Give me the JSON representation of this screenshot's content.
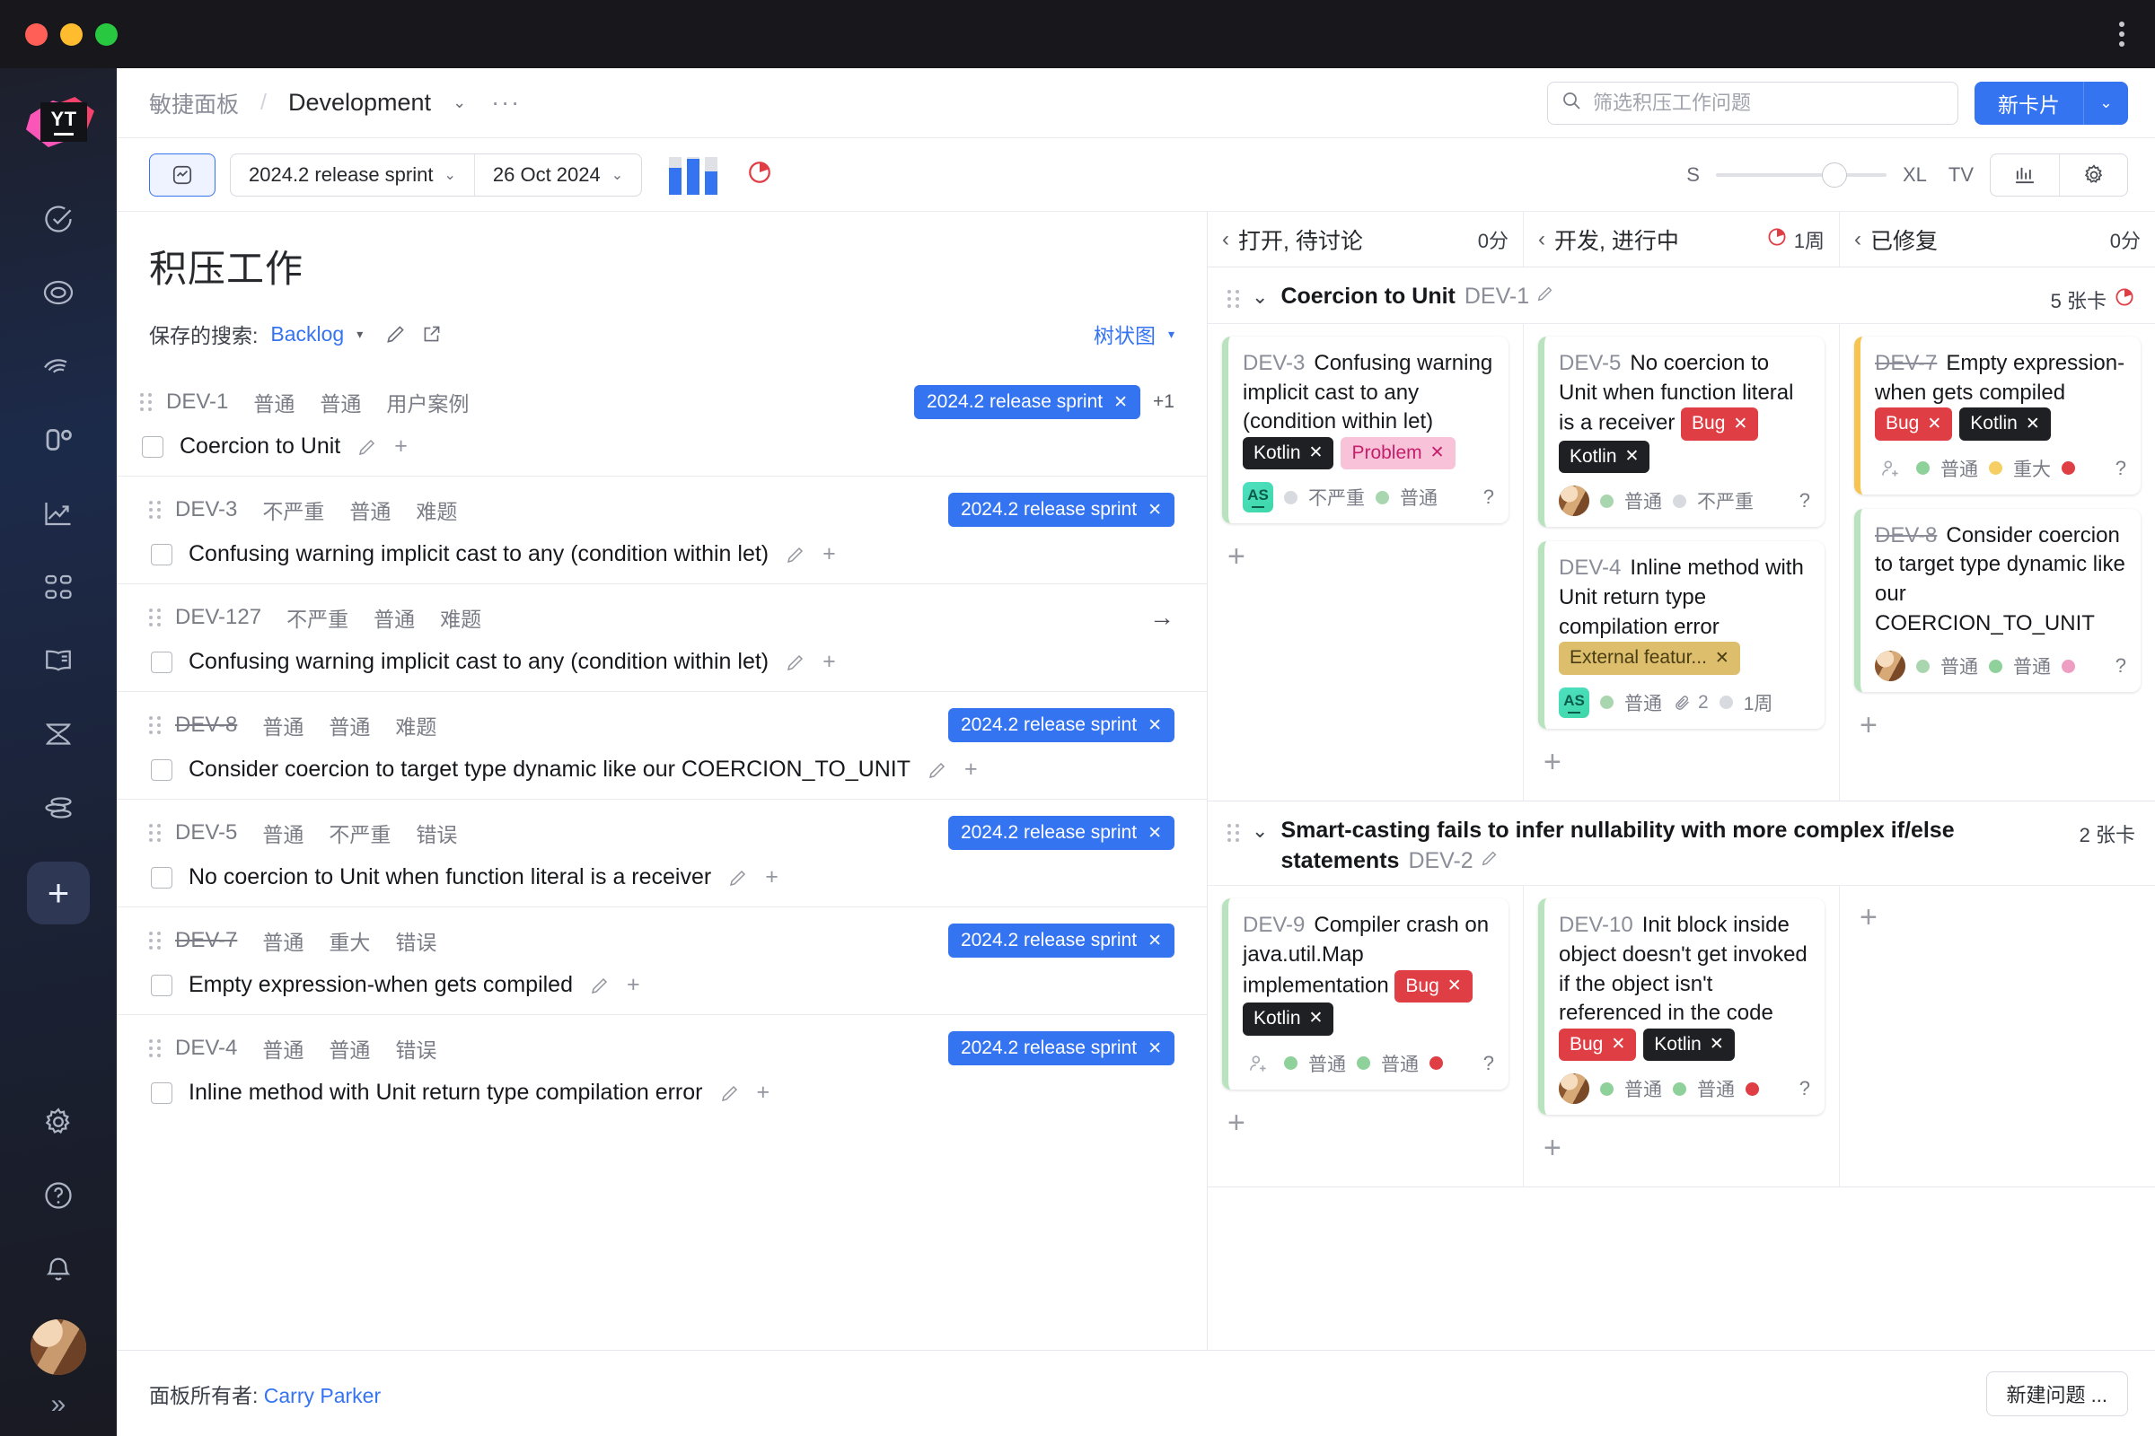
{
  "window": {
    "kebab_icon": "kebab-menu-icon"
  },
  "rail": {
    "logo_text": "YT",
    "icons": [
      {
        "name": "check-circle-icon"
      },
      {
        "name": "lifebuoy-icon"
      },
      {
        "name": "spiral-icon"
      },
      {
        "name": "zero-degree-icon"
      },
      {
        "name": "trend-chart-icon"
      },
      {
        "name": "grid-apps-icon"
      },
      {
        "name": "open-book-icon"
      },
      {
        "name": "hourglass-icon"
      },
      {
        "name": "stacked-lines-icon"
      }
    ],
    "add_label": "+",
    "bottom_icons": [
      {
        "name": "gear-icon"
      },
      {
        "name": "help-circle-icon"
      },
      {
        "name": "bell-icon"
      }
    ],
    "expand_label": "»"
  },
  "header": {
    "breadcrumb_root": "敏捷面板",
    "breadcrumb_sep": "/",
    "breadcrumb_current": "Development",
    "caret": "⌄",
    "more": "···",
    "search": {
      "placeholder": "筛选积压工作问题",
      "value": "",
      "icon": "search-icon"
    },
    "new_card_label": "新卡片",
    "new_card_caret": "⌄"
  },
  "toolbar": {
    "panel_toggle_icon": "board-panel-icon",
    "sprint_select": "2024.2 release sprint",
    "date_select": "26 Oct 2024",
    "chart_icon": "bar-chart-icon",
    "pie_icon": "pie-timer-icon",
    "size_min": "S",
    "size_max": "XL",
    "tv_label": "TV",
    "stats_icon": "statistics-icon",
    "settings_icon": "gear-icon"
  },
  "backlog": {
    "title": "积压工作",
    "saved_search_label": "保存的搜索:",
    "saved_search_value": "Backlog",
    "edit_icon": "pencil-icon",
    "open_icon": "external-link-icon",
    "view_mode": "树状图",
    "rows": [
      {
        "id": "DEV-1",
        "struck": false,
        "fields": [
          "普通",
          "普通",
          "用户案例"
        ],
        "sprint": "2024.2 release sprint",
        "extra": "+1",
        "name": "Coercion to Unit",
        "has_arrow": false
      },
      {
        "id": "DEV-3",
        "struck": false,
        "fields": [
          "不严重",
          "普通",
          "难题"
        ],
        "sprint": "2024.2 release sprint",
        "extra": "",
        "name": "Confusing warning implicit cast to any (condition within let)",
        "has_arrow": false
      },
      {
        "id": "DEV-127",
        "struck": false,
        "fields": [
          "不严重",
          "普通",
          "难题"
        ],
        "sprint": "",
        "extra": "",
        "name": "Confusing warning implicit cast to any (condition within let)",
        "has_arrow": true
      },
      {
        "id": "DEV-8",
        "struck": true,
        "fields": [
          "普通",
          "普通",
          "难题"
        ],
        "sprint": "2024.2 release sprint",
        "extra": "",
        "name": "Consider coercion to target type dynamic like our COERCION_TO_UNIT",
        "has_arrow": false
      },
      {
        "id": "DEV-5",
        "struck": false,
        "fields": [
          "普通",
          "不严重",
          "错误"
        ],
        "sprint": "2024.2 release sprint",
        "extra": "",
        "name": "No coercion to Unit when function literal is a receiver",
        "has_arrow": false
      },
      {
        "id": "DEV-7",
        "struck": true,
        "fields": [
          "普通",
          "重大",
          "错误"
        ],
        "sprint": "2024.2 release sprint",
        "extra": "",
        "name": "Empty expression-when gets compiled",
        "has_arrow": false
      },
      {
        "id": "DEV-4",
        "struck": false,
        "fields": [
          "普通",
          "普通",
          "错误"
        ],
        "sprint": "2024.2 release sprint",
        "extra": "",
        "name": "Inline method with Unit return type compilation error",
        "has_arrow": false
      }
    ]
  },
  "board": {
    "columns": [
      {
        "name": "打开, 待讨论",
        "badge": "0分",
        "badge_icon": ""
      },
      {
        "name": "开发, 进行中",
        "badge": "1周",
        "badge_icon": "pie-timer-icon"
      },
      {
        "name": "已修复",
        "badge": "0分",
        "badge_icon": ""
      }
    ],
    "swimlanes": [
      {
        "title": "Coercion to Unit",
        "id": "DEV-1",
        "edit_icon": "pencil-icon",
        "count": "5 张卡",
        "count_icon": "pie-timer-icon",
        "columns": [
          {
            "cards": [
              {
                "id": "DEV-3",
                "struck": false,
                "stripe": "green",
                "title": "Confusing warning implicit cast to any (condition within let)",
                "chips": [
                  {
                    "label": "Kotlin",
                    "style": "dark"
                  },
                  {
                    "label": "Problem",
                    "style": "pink"
                  }
                ],
                "avatar": "initials",
                "avatar_text": "AS",
                "fields": [
                  {
                    "dot": "#d7dade",
                    "text": "不严重"
                  },
                  {
                    "dot": "#a9d6ae",
                    "text": "普通"
                  }
                ],
                "attachments": "",
                "time": "",
                "question": "?"
              }
            ],
            "add": "+"
          },
          {
            "cards": [
              {
                "id": "DEV-5",
                "struck": false,
                "stripe": "green",
                "title": "No coercion to Unit when function literal is a receiver",
                "chips": [
                  {
                    "label": "Bug",
                    "style": "red"
                  },
                  {
                    "label": "Kotlin",
                    "style": "dark"
                  }
                ],
                "avatar": "photo",
                "avatar_text": "",
                "fields": [
                  {
                    "dot": "#a9d6ae",
                    "text": "普通"
                  },
                  {
                    "dot": "#d7dade",
                    "text": "不严重"
                  }
                ],
                "attachments": "",
                "time": "",
                "question": "?"
              },
              {
                "id": "DEV-4",
                "struck": false,
                "stripe": "green",
                "title": "Inline method with Unit return type compilation error",
                "chips": [
                  {
                    "label": "External featur...",
                    "style": "gold"
                  }
                ],
                "avatar": "initials",
                "avatar_text": "AS",
                "fields": [
                  {
                    "dot": "#a9d6ae",
                    "text": "普通"
                  }
                ],
                "attachments": "2",
                "time": "1周",
                "question": ""
              }
            ],
            "add": "+"
          },
          {
            "cards": [
              {
                "id": "DEV-7",
                "struck": true,
                "stripe": "amber",
                "title": "Empty expression-when gets compiled",
                "chips": [
                  {
                    "label": "Bug",
                    "style": "red"
                  },
                  {
                    "label": "Kotlin",
                    "style": "dark"
                  }
                ],
                "avatar": "add",
                "avatar_text": "",
                "fields": [
                  {
                    "dot": "#8fd19a",
                    "text": "普通"
                  },
                  {
                    "dot": "#f5cf63",
                    "text": "重大"
                  },
                  {
                    "dot": "#e03e45",
                    "text": ""
                  }
                ],
                "attachments": "",
                "time": "",
                "question": "?"
              },
              {
                "id": "DEV-8",
                "struck": true,
                "stripe": "green",
                "title": "Consider coercion to target type dynamic like our COERCION_TO_UNIT",
                "chips": [],
                "avatar": "photo",
                "avatar_text": "",
                "fields": [
                  {
                    "dot": "#a9d6ae",
                    "text": "普通"
                  },
                  {
                    "dot": "#8fd19a",
                    "text": "普通"
                  },
                  {
                    "dot": "#ef9ec3",
                    "text": ""
                  }
                ],
                "attachments": "",
                "time": "",
                "question": "?"
              }
            ],
            "add": "+"
          }
        ]
      },
      {
        "title": "Smart-casting fails to infer nullability with more complex if/else statements",
        "id": "DEV-2",
        "edit_icon": "pencil-icon",
        "count": "2 张卡",
        "count_icon": "",
        "columns": [
          {
            "cards": [
              {
                "id": "DEV-9",
                "struck": false,
                "stripe": "green",
                "title": "Compiler crash on java.util.Map implementation",
                "chips": [
                  {
                    "label": "Bug",
                    "style": "red"
                  },
                  {
                    "label": "Kotlin",
                    "style": "dark"
                  }
                ],
                "avatar": "add",
                "avatar_text": "",
                "fields": [
                  {
                    "dot": "#8fd19a",
                    "text": "普通"
                  },
                  {
                    "dot": "#8fd19a",
                    "text": "普通"
                  },
                  {
                    "dot": "#e03e45",
                    "text": ""
                  }
                ],
                "attachments": "",
                "time": "",
                "question": "?"
              }
            ],
            "add": "+"
          },
          {
            "cards": [
              {
                "id": "DEV-10",
                "struck": false,
                "stripe": "green",
                "title": "Init block inside object doesn't get invoked if the object isn't referenced in the code",
                "chips": [
                  {
                    "label": "Bug",
                    "style": "red"
                  },
                  {
                    "label": "Kotlin",
                    "style": "dark"
                  }
                ],
                "avatar": "photo",
                "avatar_text": "",
                "fields": [
                  {
                    "dot": "#8fd19a",
                    "text": "普通"
                  },
                  {
                    "dot": "#8fd19a",
                    "text": "普通"
                  },
                  {
                    "dot": "#e03e45",
                    "text": ""
                  }
                ],
                "attachments": "",
                "time": "",
                "question": "?"
              }
            ],
            "add": "+"
          },
          {
            "cards": [],
            "add": "+"
          }
        ]
      }
    ]
  },
  "footer": {
    "owner_label": "面板所有者:",
    "owner_name": "Carry Parker",
    "new_issue_label": "新建问题 ..."
  },
  "colors": {
    "accent": "#3574f0",
    "bug": "#e03e45",
    "kotlin": "#1f2024",
    "problem_bg": "#f8c2d8",
    "external": "#dcbe6d",
    "stripe_green": "#b9e3bf",
    "stripe_amber": "#f5c451"
  }
}
